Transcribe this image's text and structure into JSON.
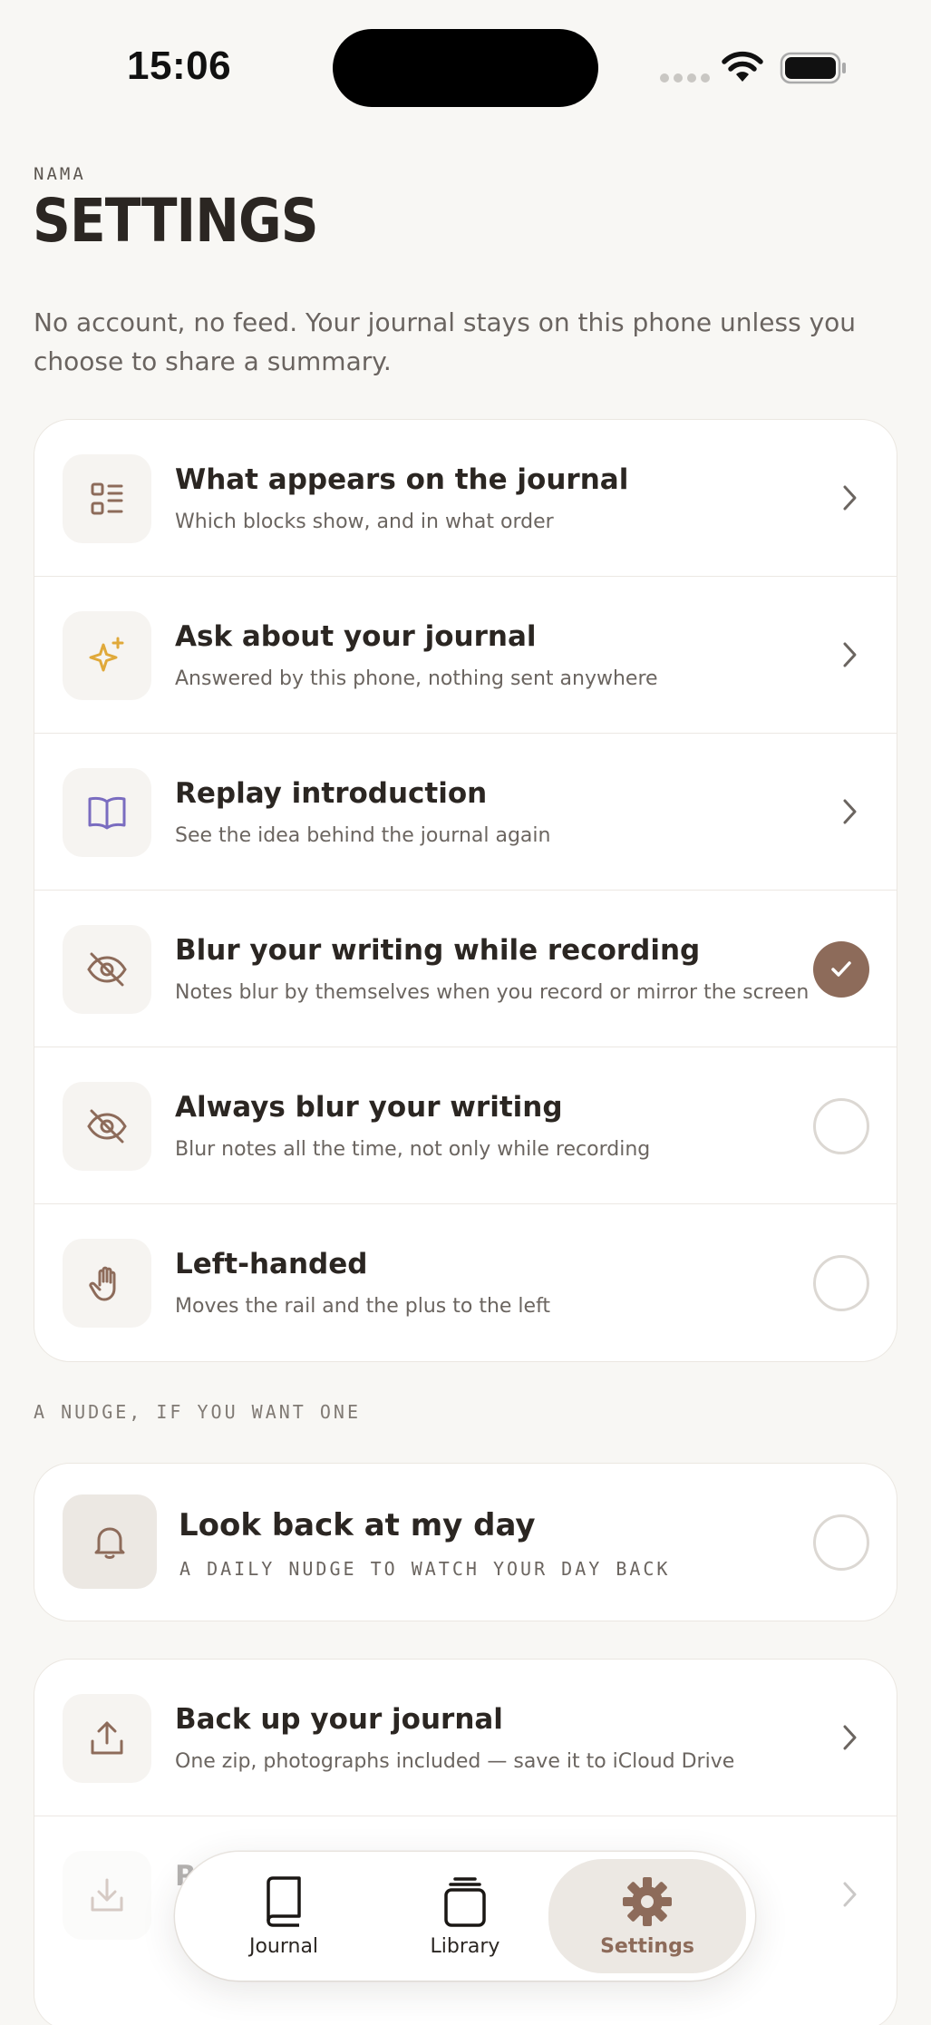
{
  "status_bar": {
    "time": "15:06"
  },
  "header": {
    "eyebrow": "NAMA",
    "title": "SETTINGS",
    "intro": "No account, no feed. Your journal stays on this phone unless you choose to share a summary."
  },
  "settings": [
    {
      "title": "What appears on the journal",
      "subtitle": "Which blocks show, and in what order",
      "icon": "list-icon",
      "control": "chevron"
    },
    {
      "title": "Ask about your journal",
      "subtitle": "Answered by this phone, nothing sent anywhere",
      "icon": "sparkle-icon",
      "control": "chevron"
    },
    {
      "title": "Replay introduction",
      "subtitle": "See the idea behind the journal again",
      "icon": "book-open-icon",
      "control": "chevron"
    },
    {
      "title": "Blur your writing while recording",
      "subtitle": "Notes blur by themselves when you record or mirror the screen",
      "icon": "eye-off-icon",
      "control": "toggle",
      "checked": true
    },
    {
      "title": "Always blur your writing",
      "subtitle": "Blur notes all the time, not only while recording",
      "icon": "eye-off-icon",
      "control": "toggle",
      "checked": false
    },
    {
      "title": "Left-handed",
      "subtitle": "Moves the rail and the plus to the left",
      "icon": "hand-icon",
      "control": "toggle",
      "checked": false
    }
  ],
  "nudge_section": {
    "label": "A NUDGE, IF YOU WANT ONE",
    "title": "Look back at my day",
    "subtitle": "A DAILY NUDGE TO WATCH YOUR DAY BACK",
    "checked": false
  },
  "data_section": [
    {
      "title": "Back up your journal",
      "subtitle": "One zip, photographs included — save it to iCloud Drive",
      "icon": "upload-icon"
    },
    {
      "title": "R",
      "subtitle": "",
      "icon": "download-icon"
    }
  ],
  "tab_bar": {
    "tabs": [
      {
        "label": "Journal",
        "icon": "book-icon"
      },
      {
        "label": "Library",
        "icon": "stack-icon"
      },
      {
        "label": "Settings",
        "icon": "gear-icon",
        "active": true
      }
    ]
  },
  "colors": {
    "background": "#f8f7f4",
    "accent": "#8d6b5a",
    "sparkle": "#e0a93a",
    "book": "#7a6cc0",
    "text": "#2b2622"
  }
}
